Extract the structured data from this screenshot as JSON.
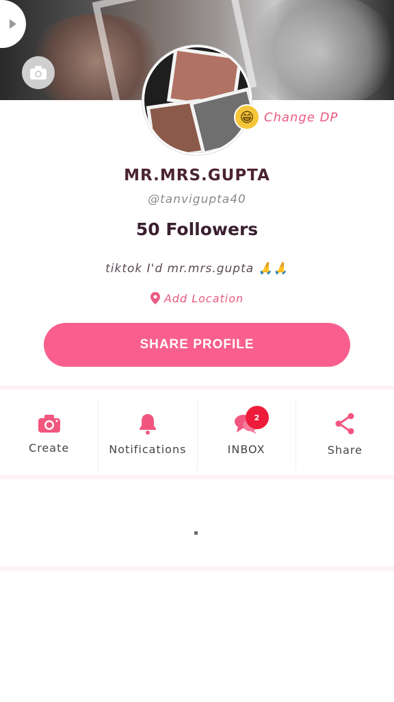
{
  "profile": {
    "name": "MR.MRS.GUPTA",
    "handle": "@tanvigupta40",
    "followers": "50 Followers",
    "bio": "tiktok I'd mr.mrs.gupta 🙏🙏",
    "location_label": "Add Location"
  },
  "avatar": {
    "change_dp_label": "Change DP",
    "emoji": "😁"
  },
  "share_profile_label": "SHARE PROFILE",
  "actions": [
    {
      "label": "Create",
      "icon": "camera-icon"
    },
    {
      "label": "Notifications",
      "icon": "bell-icon"
    },
    {
      "label": "INBOX",
      "icon": "chat-icon",
      "badge": "2"
    },
    {
      "label": "Share",
      "icon": "share-icon"
    }
  ],
  "colors": {
    "accent": "#f85f8e",
    "accent_text": "#e95a82",
    "badge": "#ee1c3b",
    "name": "#4b2433"
  }
}
